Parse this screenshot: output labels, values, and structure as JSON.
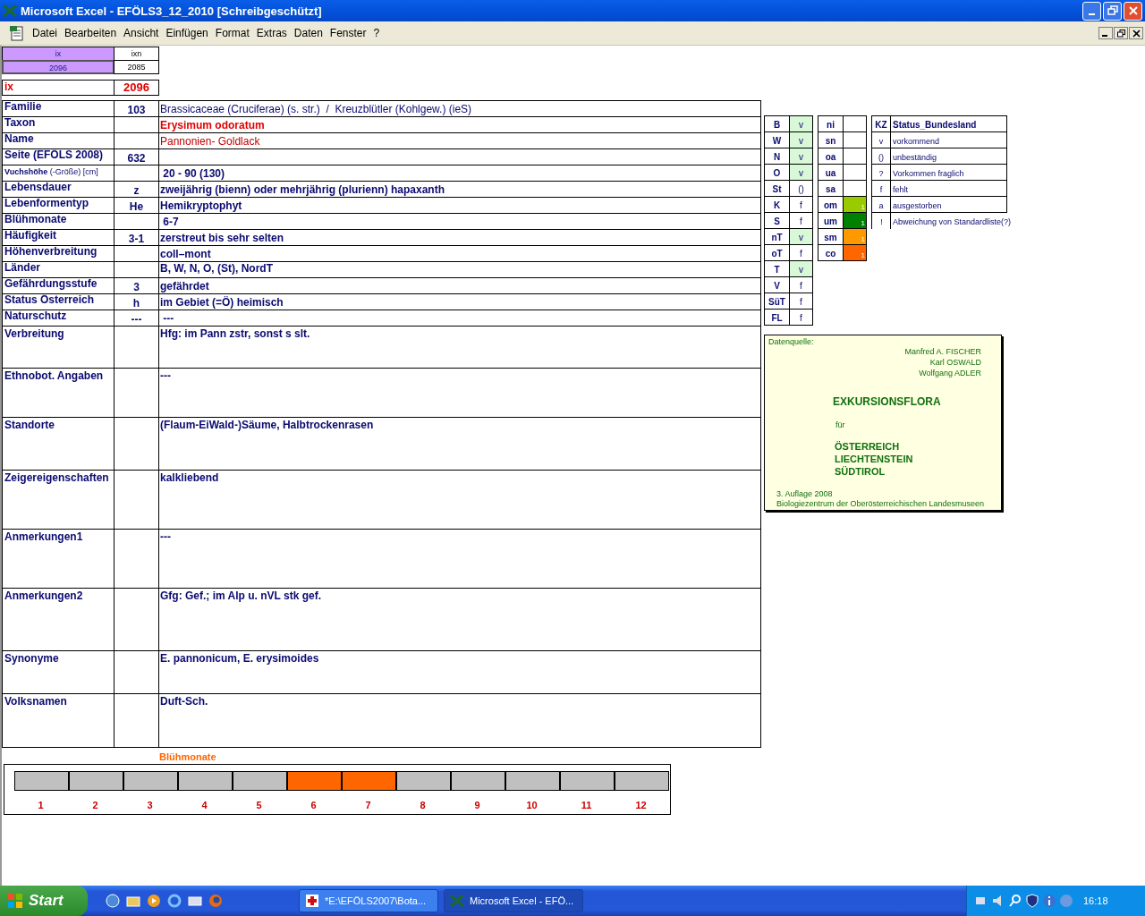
{
  "window": {
    "title": "Microsoft Excel - EFÖLS3_12_2010  [Schreibgeschützt]"
  },
  "menu": [
    "Datei",
    "Bearbeiten",
    "Ansicht",
    "Einfügen",
    "Format",
    "Extras",
    "Daten",
    "Fenster",
    "?"
  ],
  "index_cells": {
    "headers": [
      "ix",
      "ixn"
    ],
    "values": [
      "2096",
      "2085"
    ],
    "ix_label": "ix",
    "ix_value": "2096"
  },
  "rows": [
    {
      "label": "Familie",
      "code": "103",
      "value": "Brassicaceae (Cruciferae) (s. str.)  /  Kreuzblütler (Kohlgew.) (ieS)",
      "kind": "regular"
    },
    {
      "label": "Taxon",
      "value": "Erysimum odoratum",
      "kind": "taxon"
    },
    {
      "label": "Name",
      "value": "Pannonien- Goldlack",
      "kind": "vernacular"
    },
    {
      "label": "Seite (EFÖLS 2008)",
      "code": "632",
      "kind": "bold"
    },
    {
      "label": "**Vuchshöhe** (-Größe) [cm]",
      "value": " 20 - 90 (130)",
      "kind": "height"
    },
    {
      "label": "Lebensdauer",
      "code": "z",
      "value": "zweijährig (bienn) oder mehrjährig (plurienn) hapaxanth",
      "kind": "bold"
    },
    {
      "label": "Lebenformentyp",
      "code": "He",
      "value": "Hemikryptophyt",
      "kind": "bold"
    },
    {
      "label": "Blühmonate",
      "value": " 6-7",
      "kind": "bold"
    },
    {
      "label": "Häufigkeit",
      "code": "3-1",
      "value": "zerstreut bis sehr selten",
      "kind": "bold"
    },
    {
      "label": "Höhenverbreitung",
      "value": "coll–mont",
      "kind": "bold"
    },
    {
      "label": "Länder",
      "value": "B, W, N, O, (St), NordT",
      "kind": "small"
    },
    {
      "label": "Gefährdungsstufe",
      "code": "3",
      "value": "gefährdet",
      "kind": "bold"
    },
    {
      "label": "Status Österreich",
      "code": "h",
      "value": "im Gebiet (=Ö) heimisch",
      "kind": "bold"
    },
    {
      "label": "Naturschutz",
      "code": "---",
      "value": " ---",
      "kind": "bold"
    }
  ],
  "notes": [
    {
      "label": "Verbreitung",
      "value": "Hfg: im Pann zstr, sonst s slt."
    },
    {
      "label": "Ethnobot. Angaben",
      "value": "---"
    },
    {
      "label": "Standorte",
      "value": "(Flaum-EiWald-)Säume, Halbtrockenrasen"
    },
    {
      "label": "Zeigereigenschaften",
      "value": "kalkliebend"
    },
    {
      "label": "Anmerkungen1",
      "value": "---"
    },
    {
      "label": "Anmerkungen2",
      "value": "Gfg: Gef.; im Alp u. nVL stk gef."
    },
    {
      "label": "Synonyme",
      "value": "E. pannonicum, E. erysimoides"
    },
    {
      "label": "Volksnamen",
      "value": "Duft-Sch."
    }
  ],
  "states": [
    {
      "code": "B",
      "status": "v",
      "highlighted": true
    },
    {
      "code": "W",
      "status": "v",
      "highlighted": true
    },
    {
      "code": "N",
      "status": "v",
      "highlighted": true
    },
    {
      "code": "O",
      "status": "v",
      "highlighted": true
    },
    {
      "code": "St",
      "status": "()",
      "highlighted": false
    },
    {
      "code": "K",
      "status": "f",
      "highlighted": false
    },
    {
      "code": "S",
      "status": "f",
      "highlighted": false
    },
    {
      "code": "nT",
      "status": "v",
      "highlighted": true
    },
    {
      "code": "oT",
      "status": "f",
      "highlighted": false
    },
    {
      "code": "T",
      "status": "v",
      "highlighted": true
    },
    {
      "code": "V",
      "status": "f",
      "highlighted": false
    },
    {
      "code": "SüT",
      "status": "f",
      "highlighted": false
    },
    {
      "code": "FL",
      "status": "f",
      "highlighted": false
    }
  ],
  "altitude_zones": [
    {
      "code": "ni"
    },
    {
      "code": "sn"
    },
    {
      "code": "oa"
    },
    {
      "code": "ua"
    },
    {
      "code": "sa"
    },
    {
      "code": "om",
      "color": "#99cc00",
      "value": "1"
    },
    {
      "code": "um",
      "color": "#008000",
      "value": "1"
    },
    {
      "code": "sm",
      "color": "#ff9900",
      "value": "1"
    },
    {
      "code": "co",
      "color": "#ff6600",
      "value": "1"
    }
  ],
  "legend": {
    "header": [
      "KZ",
      "Status_Bundesland"
    ],
    "rows": [
      {
        "code": "v",
        "text": "vorkommend"
      },
      {
        "code": "()",
        "text": "unbeständig"
      },
      {
        "code": "?",
        "text": "Vorkommen fraglich"
      },
      {
        "code": "f",
        "text": "fehlt"
      },
      {
        "code": "a",
        "text": "ausgestorben"
      },
      {
        "code": "!",
        "text": "Abweichung von Standardliste(?)"
      }
    ]
  },
  "source": {
    "caption": "Datenquelle:",
    "authors": [
      "Manfred A. FISCHER",
      "Karl OSWALD",
      "Wolfgang ADLER"
    ],
    "title": "EXKURSIONSFLORA",
    "for": "für",
    "regions": [
      "ÖSTERREICH",
      "LIECHTENSTEIN",
      "SÜDTIROL"
    ],
    "edition": "3. Auflage 2008",
    "publisher": "Biologiezentrum der Oberösterreichischen Landesmuseen"
  },
  "flowering": {
    "title": "Blühmonate",
    "months": [
      {
        "label": "1",
        "selected": false
      },
      {
        "label": "2",
        "selected": false
      },
      {
        "label": "3",
        "selected": false
      },
      {
        "label": "4",
        "selected": false
      },
      {
        "label": "5",
        "selected": false
      },
      {
        "label": "6",
        "selected": true
      },
      {
        "label": "7",
        "selected": true
      },
      {
        "label": "8",
        "selected": false
      },
      {
        "label": "9",
        "selected": false
      },
      {
        "label": "10",
        "selected": false
      },
      {
        "label": "11",
        "selected": false
      },
      {
        "label": "12",
        "selected": false
      }
    ]
  },
  "taskbar": {
    "start": "Start",
    "tasks": [
      {
        "label": "*E:\\EFÖLS2007\\Bota...",
        "selected": false
      },
      {
        "label": "Microsoft Excel - EFÖ...",
        "selected": true
      }
    ],
    "time": "16:18"
  }
}
